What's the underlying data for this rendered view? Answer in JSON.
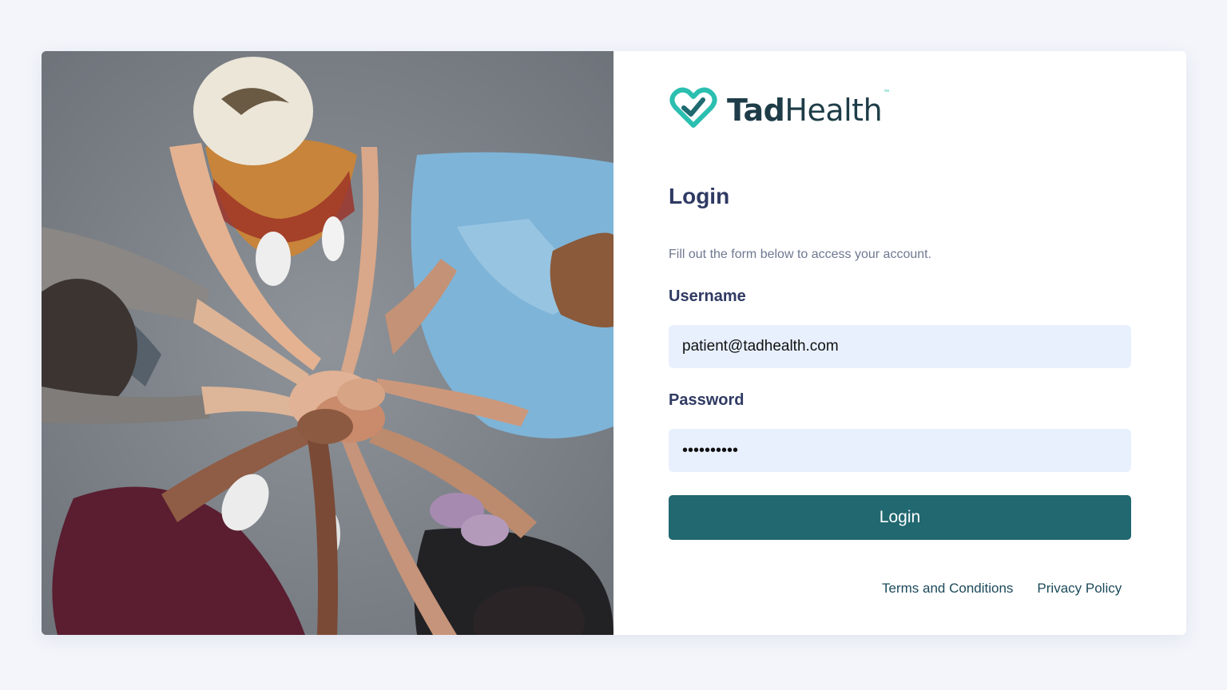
{
  "brand": {
    "name_part1": "Tad",
    "name_part2": "Health",
    "trademark": "™",
    "logo_icon": "heart-check-icon",
    "colors": {
      "icon": "#2bbfb0",
      "text": "#1e3d48"
    }
  },
  "photo": {
    "description_icon": "team-hands-photo"
  },
  "login": {
    "title": "Login",
    "subtitle": "Fill out the form below to access your account.",
    "username_label": "Username",
    "username_value": "patient@tadhealth.com",
    "password_label": "Password",
    "password_value": "••••••••••",
    "submit_label": "Login",
    "colors": {
      "button": "#216870",
      "input_bg": "#e8f0fe",
      "heading": "#2f3a63"
    }
  },
  "footer": {
    "links": [
      {
        "label": "Terms and Conditions"
      },
      {
        "label": "Privacy Policy"
      }
    ]
  }
}
